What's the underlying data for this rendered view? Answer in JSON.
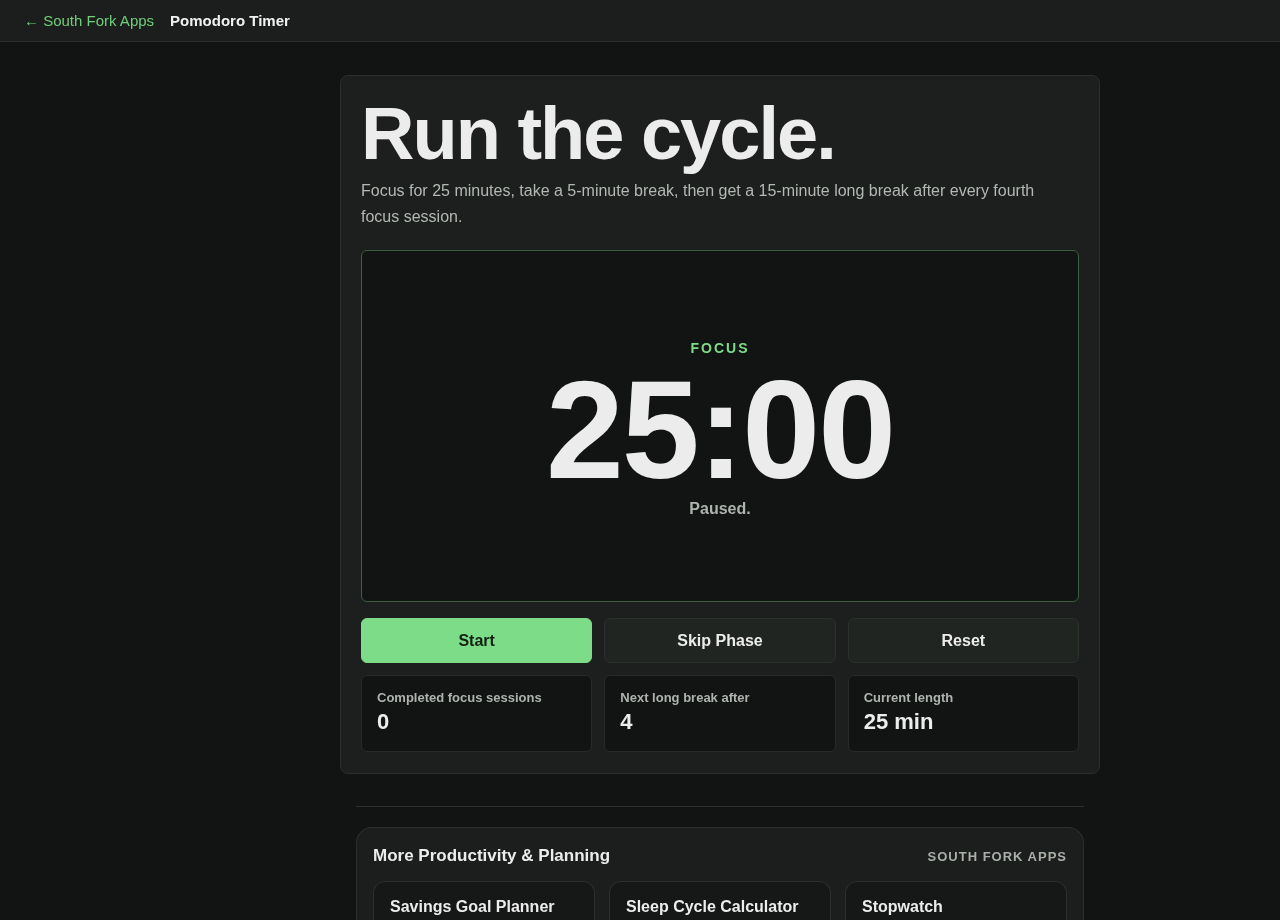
{
  "header": {
    "back_link": "← South Fork Apps",
    "page_title": "Pomodoro Timer"
  },
  "hero": {
    "title": "Run the cycle.",
    "description": "Focus for 25 minutes, take a 5-minute break, then get a 15-minute long break after every fourth focus session."
  },
  "timer": {
    "phase": "FOCUS",
    "time": "25:00",
    "status": "Paused."
  },
  "buttons": [
    {
      "label": "Start",
      "kind": "primary"
    },
    {
      "label": "Skip Phase",
      "kind": "secondary"
    },
    {
      "label": "Reset",
      "kind": "secondary"
    }
  ],
  "stats": [
    {
      "label": "Completed focus sessions",
      "value": "0"
    },
    {
      "label": "Next long break after",
      "value": "4"
    },
    {
      "label": "Current length",
      "value": "25 min"
    }
  ],
  "related": {
    "title": "More Productivity & Planning",
    "brand": "SOUTH FORK APPS",
    "tools": [
      {
        "title": "Savings Goal Planner"
      },
      {
        "title": "Sleep Cycle Calculator"
      },
      {
        "title": "Stopwatch"
      }
    ]
  }
}
